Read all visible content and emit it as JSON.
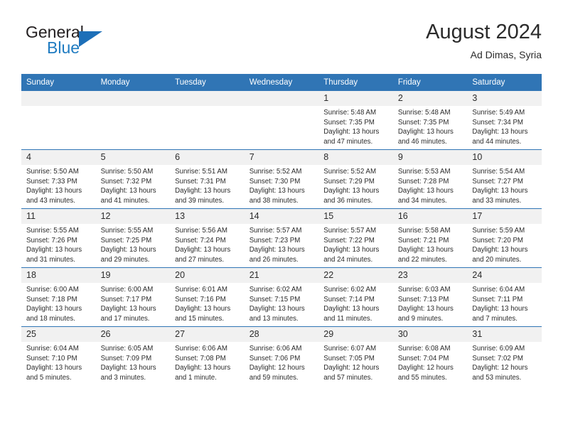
{
  "logo": {
    "text_top": "General",
    "text_bottom": "Blue",
    "triangle_color": "#1d6fb8",
    "blue_color": "#1f7bc1"
  },
  "header": {
    "title": "August 2024",
    "subtitle": "Ad Dimas, Syria"
  },
  "theme": {
    "header_blue": "#3075b5",
    "daynum_band": "#f1f1f1",
    "text": "#2b2b2b"
  },
  "weekday_headers": [
    "Sunday",
    "Monday",
    "Tuesday",
    "Wednesday",
    "Thursday",
    "Friday",
    "Saturday"
  ],
  "weeks": [
    [
      {
        "day": "",
        "sunrise": "",
        "sunset": "",
        "daylight_line1": "",
        "daylight_line2": ""
      },
      {
        "day": "",
        "sunrise": "",
        "sunset": "",
        "daylight_line1": "",
        "daylight_line2": ""
      },
      {
        "day": "",
        "sunrise": "",
        "sunset": "",
        "daylight_line1": "",
        "daylight_line2": ""
      },
      {
        "day": "",
        "sunrise": "",
        "sunset": "",
        "daylight_line1": "",
        "daylight_line2": ""
      },
      {
        "day": "1",
        "sunrise": "Sunrise: 5:48 AM",
        "sunset": "Sunset: 7:35 PM",
        "daylight_line1": "Daylight: 13 hours",
        "daylight_line2": "and 47 minutes."
      },
      {
        "day": "2",
        "sunrise": "Sunrise: 5:48 AM",
        "sunset": "Sunset: 7:35 PM",
        "daylight_line1": "Daylight: 13 hours",
        "daylight_line2": "and 46 minutes."
      },
      {
        "day": "3",
        "sunrise": "Sunrise: 5:49 AM",
        "sunset": "Sunset: 7:34 PM",
        "daylight_line1": "Daylight: 13 hours",
        "daylight_line2": "and 44 minutes."
      }
    ],
    [
      {
        "day": "4",
        "sunrise": "Sunrise: 5:50 AM",
        "sunset": "Sunset: 7:33 PM",
        "daylight_line1": "Daylight: 13 hours",
        "daylight_line2": "and 43 minutes."
      },
      {
        "day": "5",
        "sunrise": "Sunrise: 5:50 AM",
        "sunset": "Sunset: 7:32 PM",
        "daylight_line1": "Daylight: 13 hours",
        "daylight_line2": "and 41 minutes."
      },
      {
        "day": "6",
        "sunrise": "Sunrise: 5:51 AM",
        "sunset": "Sunset: 7:31 PM",
        "daylight_line1": "Daylight: 13 hours",
        "daylight_line2": "and 39 minutes."
      },
      {
        "day": "7",
        "sunrise": "Sunrise: 5:52 AM",
        "sunset": "Sunset: 7:30 PM",
        "daylight_line1": "Daylight: 13 hours",
        "daylight_line2": "and 38 minutes."
      },
      {
        "day": "8",
        "sunrise": "Sunrise: 5:52 AM",
        "sunset": "Sunset: 7:29 PM",
        "daylight_line1": "Daylight: 13 hours",
        "daylight_line2": "and 36 minutes."
      },
      {
        "day": "9",
        "sunrise": "Sunrise: 5:53 AM",
        "sunset": "Sunset: 7:28 PM",
        "daylight_line1": "Daylight: 13 hours",
        "daylight_line2": "and 34 minutes."
      },
      {
        "day": "10",
        "sunrise": "Sunrise: 5:54 AM",
        "sunset": "Sunset: 7:27 PM",
        "daylight_line1": "Daylight: 13 hours",
        "daylight_line2": "and 33 minutes."
      }
    ],
    [
      {
        "day": "11",
        "sunrise": "Sunrise: 5:55 AM",
        "sunset": "Sunset: 7:26 PM",
        "daylight_line1": "Daylight: 13 hours",
        "daylight_line2": "and 31 minutes."
      },
      {
        "day": "12",
        "sunrise": "Sunrise: 5:55 AM",
        "sunset": "Sunset: 7:25 PM",
        "daylight_line1": "Daylight: 13 hours",
        "daylight_line2": "and 29 minutes."
      },
      {
        "day": "13",
        "sunrise": "Sunrise: 5:56 AM",
        "sunset": "Sunset: 7:24 PM",
        "daylight_line1": "Daylight: 13 hours",
        "daylight_line2": "and 27 minutes."
      },
      {
        "day": "14",
        "sunrise": "Sunrise: 5:57 AM",
        "sunset": "Sunset: 7:23 PM",
        "daylight_line1": "Daylight: 13 hours",
        "daylight_line2": "and 26 minutes."
      },
      {
        "day": "15",
        "sunrise": "Sunrise: 5:57 AM",
        "sunset": "Sunset: 7:22 PM",
        "daylight_line1": "Daylight: 13 hours",
        "daylight_line2": "and 24 minutes."
      },
      {
        "day": "16",
        "sunrise": "Sunrise: 5:58 AM",
        "sunset": "Sunset: 7:21 PM",
        "daylight_line1": "Daylight: 13 hours",
        "daylight_line2": "and 22 minutes."
      },
      {
        "day": "17",
        "sunrise": "Sunrise: 5:59 AM",
        "sunset": "Sunset: 7:20 PM",
        "daylight_line1": "Daylight: 13 hours",
        "daylight_line2": "and 20 minutes."
      }
    ],
    [
      {
        "day": "18",
        "sunrise": "Sunrise: 6:00 AM",
        "sunset": "Sunset: 7:18 PM",
        "daylight_line1": "Daylight: 13 hours",
        "daylight_line2": "and 18 minutes."
      },
      {
        "day": "19",
        "sunrise": "Sunrise: 6:00 AM",
        "sunset": "Sunset: 7:17 PM",
        "daylight_line1": "Daylight: 13 hours",
        "daylight_line2": "and 17 minutes."
      },
      {
        "day": "20",
        "sunrise": "Sunrise: 6:01 AM",
        "sunset": "Sunset: 7:16 PM",
        "daylight_line1": "Daylight: 13 hours",
        "daylight_line2": "and 15 minutes."
      },
      {
        "day": "21",
        "sunrise": "Sunrise: 6:02 AM",
        "sunset": "Sunset: 7:15 PM",
        "daylight_line1": "Daylight: 13 hours",
        "daylight_line2": "and 13 minutes."
      },
      {
        "day": "22",
        "sunrise": "Sunrise: 6:02 AM",
        "sunset": "Sunset: 7:14 PM",
        "daylight_line1": "Daylight: 13 hours",
        "daylight_line2": "and 11 minutes."
      },
      {
        "day": "23",
        "sunrise": "Sunrise: 6:03 AM",
        "sunset": "Sunset: 7:13 PM",
        "daylight_line1": "Daylight: 13 hours",
        "daylight_line2": "and 9 minutes."
      },
      {
        "day": "24",
        "sunrise": "Sunrise: 6:04 AM",
        "sunset": "Sunset: 7:11 PM",
        "daylight_line1": "Daylight: 13 hours",
        "daylight_line2": "and 7 minutes."
      }
    ],
    [
      {
        "day": "25",
        "sunrise": "Sunrise: 6:04 AM",
        "sunset": "Sunset: 7:10 PM",
        "daylight_line1": "Daylight: 13 hours",
        "daylight_line2": "and 5 minutes."
      },
      {
        "day": "26",
        "sunrise": "Sunrise: 6:05 AM",
        "sunset": "Sunset: 7:09 PM",
        "daylight_line1": "Daylight: 13 hours",
        "daylight_line2": "and 3 minutes."
      },
      {
        "day": "27",
        "sunrise": "Sunrise: 6:06 AM",
        "sunset": "Sunset: 7:08 PM",
        "daylight_line1": "Daylight: 13 hours",
        "daylight_line2": "and 1 minute."
      },
      {
        "day": "28",
        "sunrise": "Sunrise: 6:06 AM",
        "sunset": "Sunset: 7:06 PM",
        "daylight_line1": "Daylight: 12 hours",
        "daylight_line2": "and 59 minutes."
      },
      {
        "day": "29",
        "sunrise": "Sunrise: 6:07 AM",
        "sunset": "Sunset: 7:05 PM",
        "daylight_line1": "Daylight: 12 hours",
        "daylight_line2": "and 57 minutes."
      },
      {
        "day": "30",
        "sunrise": "Sunrise: 6:08 AM",
        "sunset": "Sunset: 7:04 PM",
        "daylight_line1": "Daylight: 12 hours",
        "daylight_line2": "and 55 minutes."
      },
      {
        "day": "31",
        "sunrise": "Sunrise: 6:09 AM",
        "sunset": "Sunset: 7:02 PM",
        "daylight_line1": "Daylight: 12 hours",
        "daylight_line2": "and 53 minutes."
      }
    ]
  ]
}
